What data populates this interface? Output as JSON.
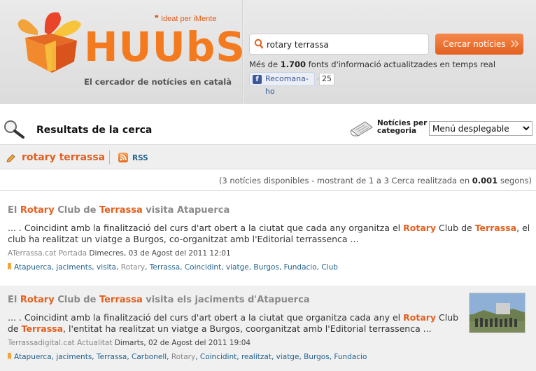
{
  "header": {
    "logo_text": "HUUbS",
    "tagline_top_quote": "❞",
    "tagline_top": "Ideat per iMente",
    "tagline": "El cercador de notícies en català",
    "search_value": "rotary terrassa",
    "search_button": "Cercar notícies",
    "sources_prefix": "Més de",
    "sources_count": "1.700",
    "sources_suffix": "fonts d'informació actualitzades en temps real",
    "fb_like": "Recomana-ho",
    "fb_count": "25",
    "colors": {
      "accent": "#e2601f",
      "link": "#23628b",
      "fb": "#3b5998"
    }
  },
  "results_bar": {
    "title": "Resultats de la cerca",
    "category_label": "Notícies per categoria",
    "category_select": "Menú desplegable"
  },
  "query": {
    "text": "rotary terrassa",
    "rss": "RSS"
  },
  "summary": {
    "prefix": "(3 notícies disponibles - mostrant de 1 a 3 Cerca realitzada en",
    "time": "0.001",
    "suffix": "segons)"
  },
  "results": [
    {
      "title": [
        "El ",
        "Rotary",
        " Club de ",
        "Terrassa",
        " visita Atapuerca"
      ],
      "snippet_line1": [
        "... . Coincidint amb la finalització del curs d'art obert a la ciutat que cada any organitza el ",
        "Rotary",
        " Club de ",
        "Terrassa",
        ", el"
      ],
      "snippet_line2": "club ha realitzat un viatge a Burgos, co-organitzat amb l'Editorial terrassenca ...",
      "source": "ATerrassa.cat Portada",
      "date": "Dimecres, 03 de Agost del 2011 12:01",
      "tags": [
        "Atapuerca",
        "jaciments",
        "visita",
        "Rotary",
        "Terrassa",
        "Coincidint",
        "viatge",
        "Burgos",
        "Fundacio",
        "Club"
      ]
    },
    {
      "title": [
        "El ",
        "Rotary",
        " Club de ",
        "Terrassa",
        " visita els jaciments d'Atapuerca"
      ],
      "snippet_line1": [
        "... . Coincidint amb la finalització del curs d'art obert a la ciutat que organitza cada any el ",
        "Rotary",
        " Club"
      ],
      "snippet_line2_prefix": "de ",
      "snippet_line2_hl": "Terrassa",
      "snippet_line2": ", l'entitat ha realitzat un viatge a Burgos, coorganitzat amb l'Editorial terrassenca ...",
      "source": "Terrassadigital.cat Actualitat",
      "date": "Dimarts, 02 de Agost del 2011 19:04",
      "tags": [
        "Atapuerca",
        "jaciments",
        "Terrassa",
        "Carbonell",
        "Rotary",
        "Coincidint",
        "realitzat",
        "viatge",
        "Burgos",
        "Fundacio"
      ]
    }
  ]
}
